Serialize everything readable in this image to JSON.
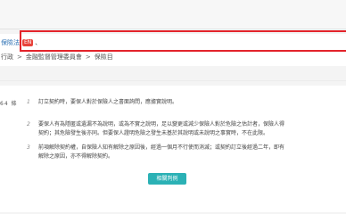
{
  "law": {
    "title": "保險法",
    "en_badge": "EN",
    "title_suffix": "、"
  },
  "breadcrumb": {
    "items": [
      "行政",
      "金融監督管理委員會",
      "保險目"
    ],
    "separator": ">"
  },
  "article": {
    "number_label": "64 條",
    "paragraphs": [
      {
        "num": "1",
        "lines": [
          "訂立契約時，要保人對於保險人之書面詢問，應據實說明。"
        ]
      },
      {
        "num": "2",
        "lines": [
          "要保人有為隱匿或遺漏不為說明，或為不實之說明，足以變更或減少保險人對於危險之估計者，保險人得",
          "契約；其危險發生後亦同。但要保人證明危險之發生未基於其說明或未說明之事實時，不在此限。"
        ]
      },
      {
        "num": "3",
        "lines": [
          "前項解除契約權，自保險人知有解除之原因後，經過一個月不行使而消滅；或契約訂立後經過二年，即有",
          "解除之原因，亦不得解除契約。"
        ]
      }
    ]
  },
  "buttons": {
    "related_cases": "相關判例"
  },
  "colors": {
    "link": "#2a6fb3",
    "badge": "#e8433b",
    "highlight_border": "#e3242b",
    "button": "#2bb1b5"
  }
}
